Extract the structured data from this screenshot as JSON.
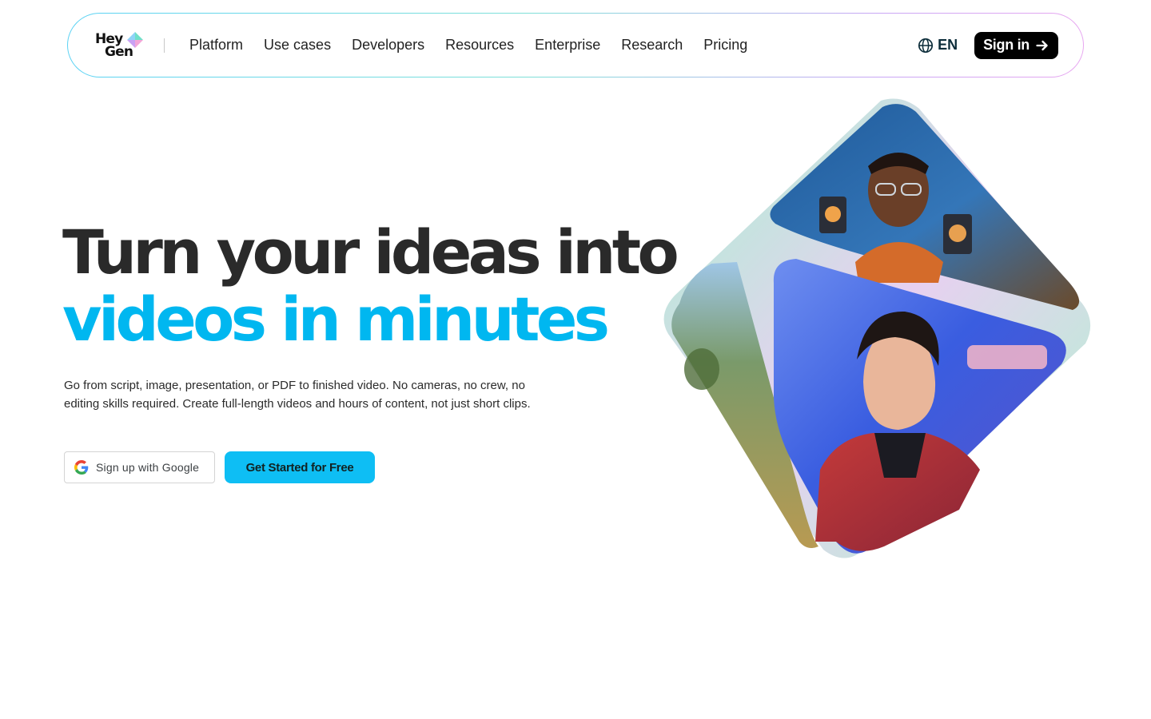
{
  "nav": {
    "logo_line1": "Hey",
    "logo_line2": "Gen",
    "links": [
      "Platform",
      "Use cases",
      "Developers",
      "Resources",
      "Enterprise",
      "Research",
      "Pricing"
    ],
    "language": "EN",
    "signin_label": "Sign in"
  },
  "hero": {
    "title_line1": "Turn your ideas into",
    "title_line2": "videos in minutes",
    "subtitle": "Go from script, image, presentation, or PDF to finished video. No cameras, no crew, no editing skills required. Create full-length videos and hours of content, not just short clips.",
    "google_button": "Sign up with Google",
    "primary_button": "Get Started for Free"
  },
  "icons": {
    "globe": "globe-icon",
    "arrow": "arrow-right-icon",
    "google": "google-g-icon",
    "logo": "heygen-logo-mark-icon"
  },
  "colors": {
    "accent": "#00b7f0",
    "primary_button": "#0ebef4",
    "title_dark": "#2a2a2a",
    "signin_bg": "#000000"
  }
}
